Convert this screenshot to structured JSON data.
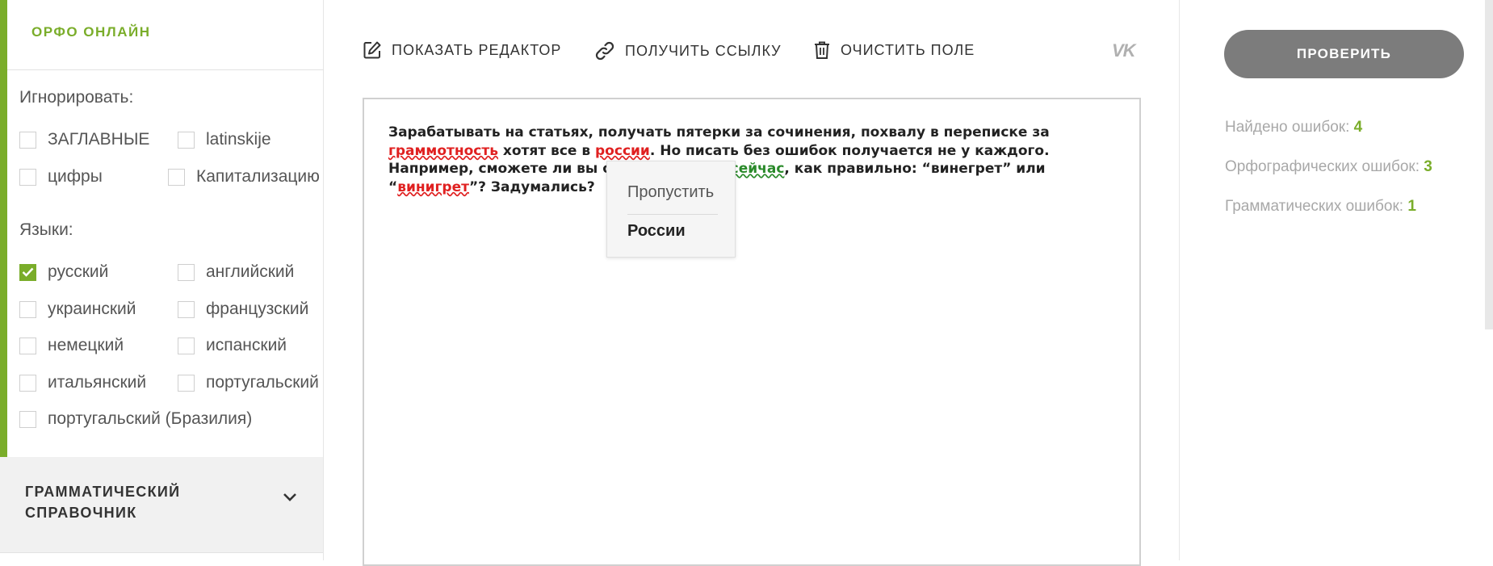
{
  "brand": "ОРФО ОНЛАЙН",
  "ignore": {
    "title": "Игнорировать:",
    "options": [
      {
        "label": "ЗАГЛАВНЫЕ",
        "checked": false
      },
      {
        "label": "latinskije",
        "checked": false
      },
      {
        "label": "цифры",
        "checked": false
      },
      {
        "label": "Капитализацию",
        "checked": false
      }
    ]
  },
  "languages": {
    "title": "Языки:",
    "options": [
      {
        "label": "русский",
        "checked": true
      },
      {
        "label": "английский",
        "checked": false
      },
      {
        "label": "украинский",
        "checked": false
      },
      {
        "label": "французский",
        "checked": false
      },
      {
        "label": "немецкий",
        "checked": false
      },
      {
        "label": "испанский",
        "checked": false
      },
      {
        "label": "итальянский",
        "checked": false
      },
      {
        "label": "португальский",
        "checked": false
      },
      {
        "label": "португальский (Бразилия)",
        "checked": false
      }
    ]
  },
  "grammar_ref": {
    "line1": "ГРАММАТИЧЕСКИЙ",
    "line2": "СПРАВОЧНИК"
  },
  "toolbar": {
    "show_editor": "ПОКАЗАТЬ РЕДАКТОР",
    "get_link": "ПОЛУЧИТЬ ССЫЛКУ",
    "clear_field": "ОЧИСТИТЬ ПОЛЕ",
    "vk": "VK"
  },
  "editor": {
    "t1": "Зарабатывать на статьях, получать пятерки за сочинения, похвалу в переписке за ",
    "e1": "граммотность",
    "t2": " хотят все в ",
    "e2": "россии",
    "t3": ". Но писать без ошибок получается не у каждого. Например, сможете ли вы ответить прямо ",
    "e3": "сейчас",
    "t4": ", как правильно: “винегрет” или “",
    "e4": "винигрет",
    "t5": "”? Задумались?"
  },
  "popup": {
    "skip": "Пропустить",
    "suggestion": "России"
  },
  "check_button": "ПРОВЕРИТЬ",
  "stats": {
    "found_label": "Найдено ошибок: ",
    "found": "4",
    "spelling_label": "Орфографических ошибок: ",
    "spelling": "3",
    "grammar_label": "Грамматических ошибок: ",
    "grammar": "1"
  },
  "colors": {
    "accent": "#7aad2a",
    "error": "#e02020",
    "grammar_error": "#2a8a2a",
    "button": "#7c7c7c"
  }
}
